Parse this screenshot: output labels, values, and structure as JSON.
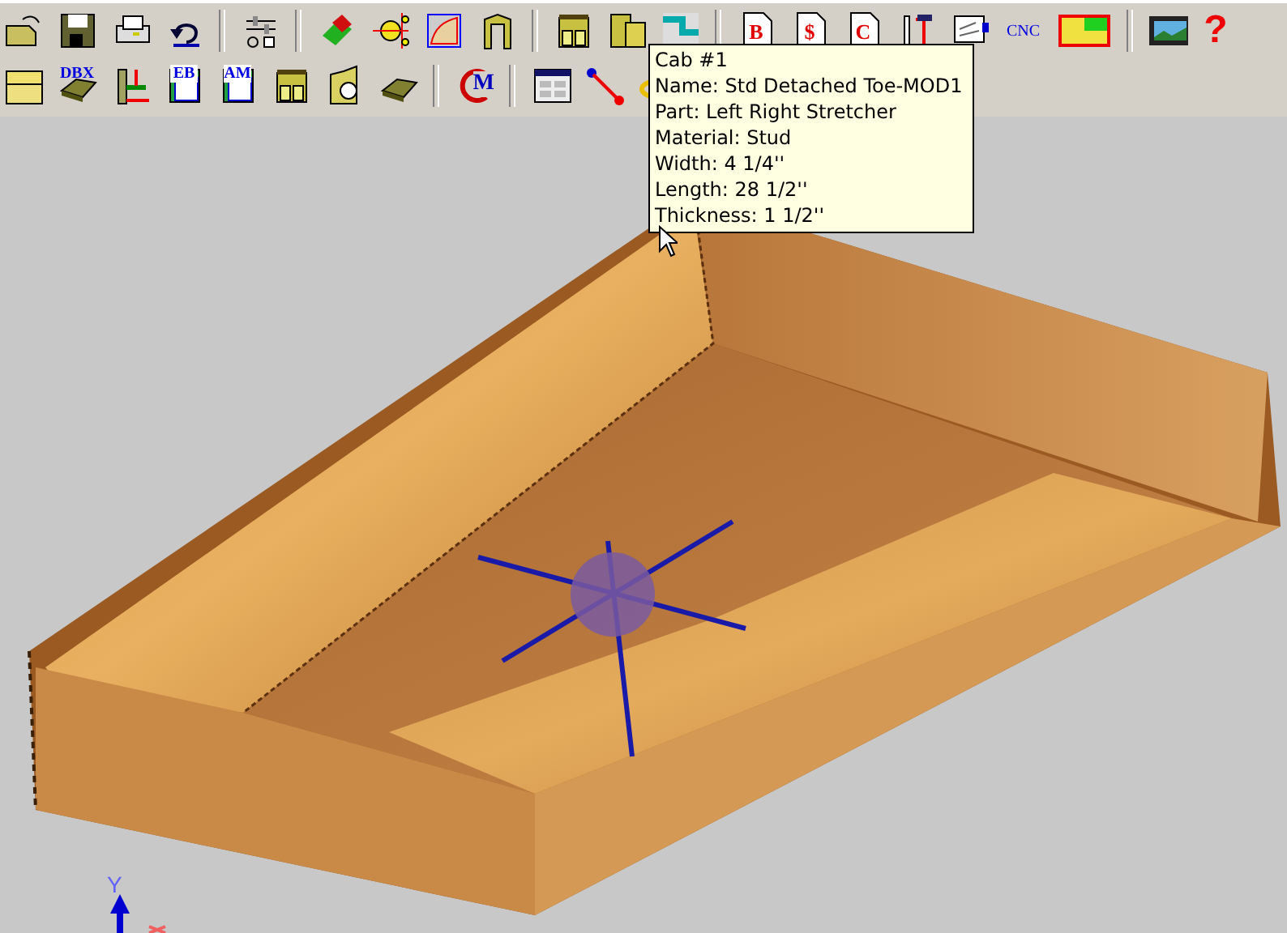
{
  "toolbar_rows": [
    [
      {
        "kind": "open"
      },
      {
        "kind": "save"
      },
      {
        "kind": "print"
      },
      {
        "kind": "undo"
      },
      {
        "kind": "separator"
      },
      {
        "kind": "settings"
      },
      {
        "kind": "separator"
      },
      {
        "kind": "paint"
      },
      {
        "kind": "light"
      },
      {
        "kind": "profile"
      },
      {
        "kind": "frame"
      },
      {
        "kind": "separator"
      },
      {
        "kind": "cabinet"
      },
      {
        "kind": "cabinets"
      },
      {
        "kind": "layout"
      },
      {
        "kind": "separator"
      },
      {
        "kind": "doc",
        "label": "B"
      },
      {
        "kind": "doc",
        "label": "$"
      },
      {
        "kind": "doc",
        "label": "C"
      },
      {
        "kind": "measure"
      },
      {
        "kind": "sign"
      },
      {
        "kind": "text",
        "label": "CNC"
      },
      {
        "kind": "floorplan"
      },
      {
        "kind": "separator"
      },
      {
        "kind": "film"
      },
      {
        "kind": "text",
        "label": "?"
      }
    ],
    [
      {
        "kind": "drawer"
      },
      {
        "kind": "tray",
        "label": "DBX"
      },
      {
        "kind": "dimension"
      },
      {
        "kind": "panel",
        "label": "EB"
      },
      {
        "kind": "panel",
        "label": "AM"
      },
      {
        "kind": "cabinet"
      },
      {
        "kind": "gable"
      },
      {
        "kind": "tray"
      },
      {
        "kind": "separator"
      },
      {
        "kind": "magnet",
        "label": "M"
      },
      {
        "kind": "separator"
      },
      {
        "kind": "window"
      },
      {
        "kind": "pointer"
      },
      {
        "kind": "rotate"
      }
    ]
  ],
  "tooltip": {
    "lines": [
      "Cab #1",
      "Name: Std Detached Toe-MOD1",
      "Part: Left Right Stretcher",
      "Material: Stud",
      "Width: 4 1/4''",
      "Length: 28 1/2''",
      "Thickness: 1 1/2''"
    ]
  },
  "axes": {
    "y_label": "Y"
  }
}
